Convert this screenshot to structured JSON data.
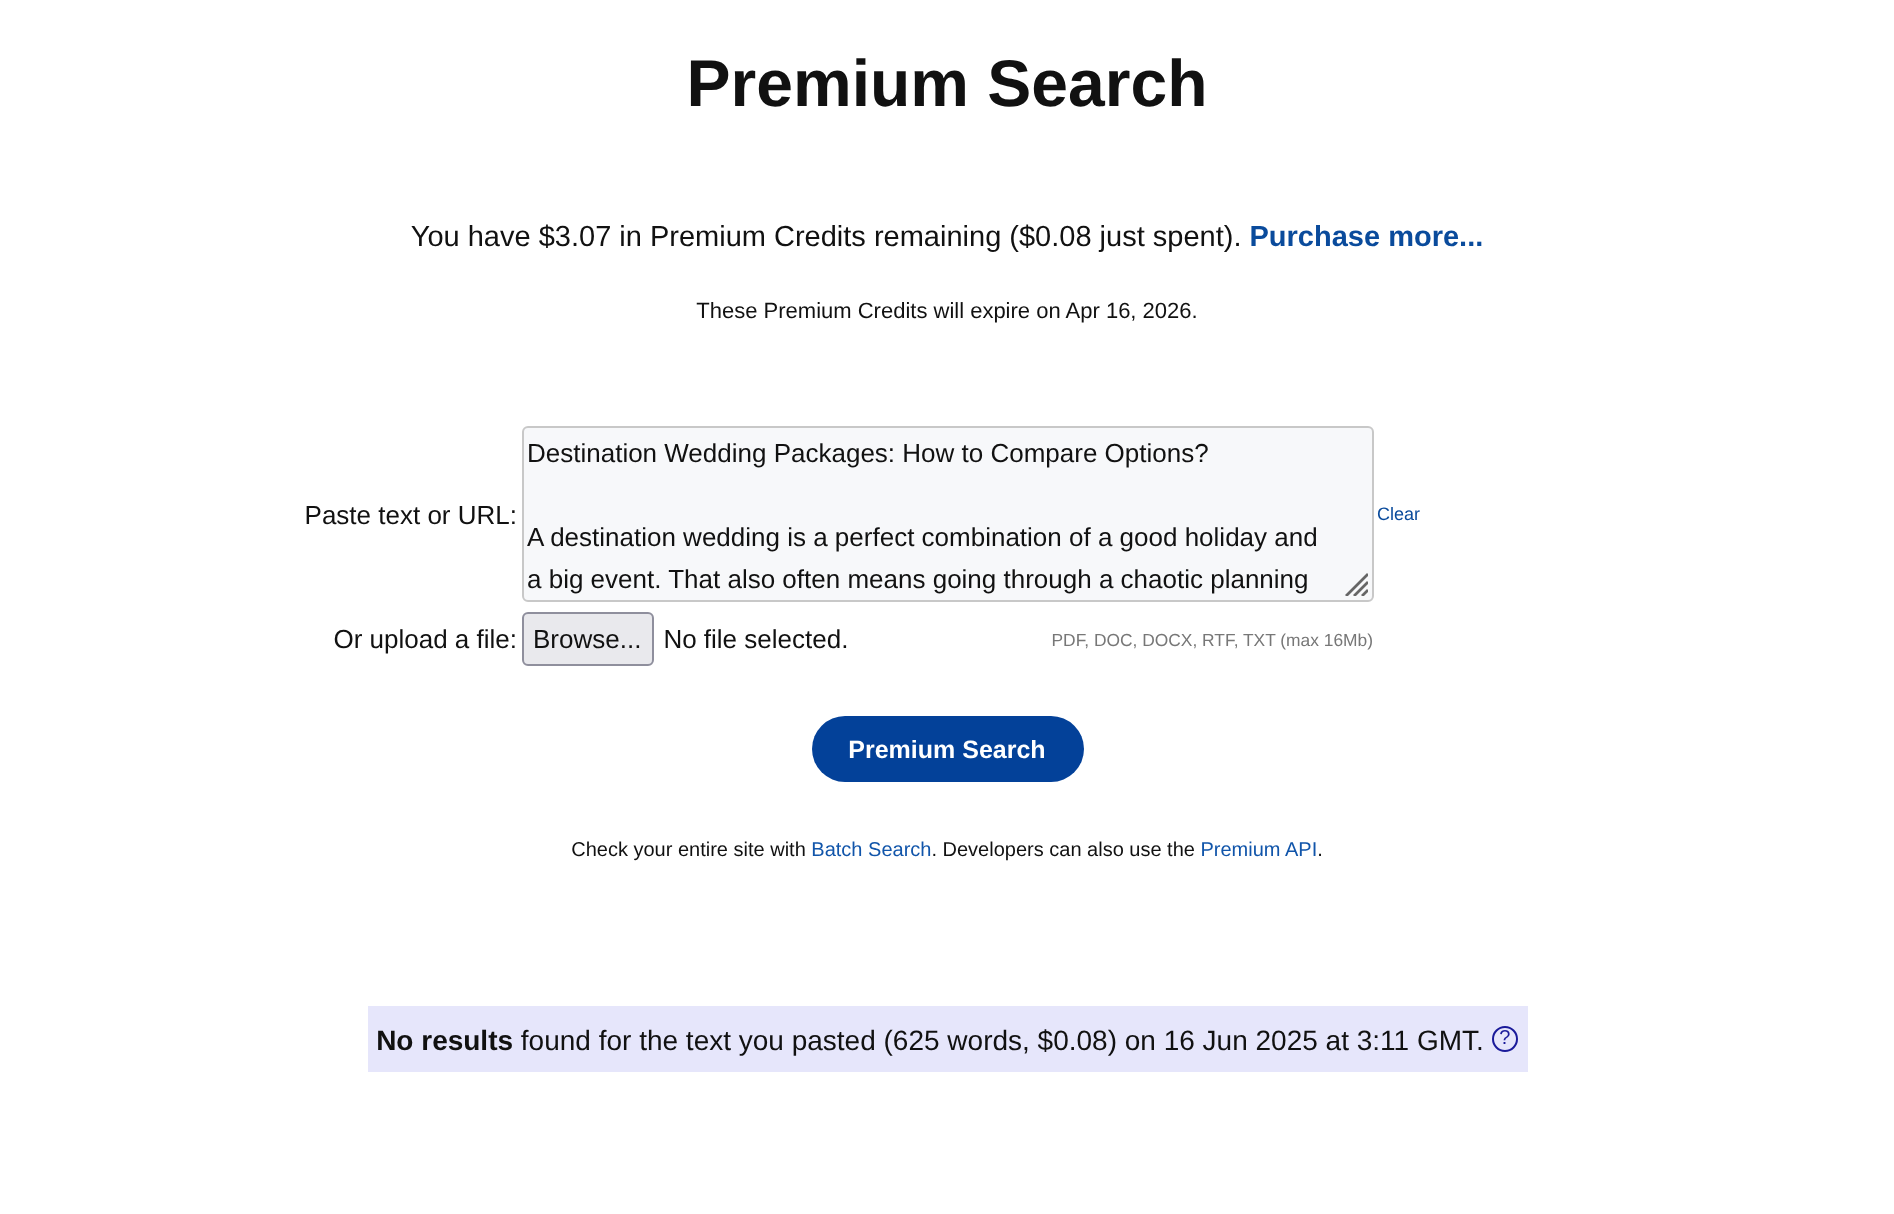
{
  "title": "Premium Search",
  "credits": {
    "text": "You have $3.07 in Premium Credits remaining ($0.08 just spent).",
    "link": "Purchase more..."
  },
  "expiry": "These Premium Credits will expire on Apr 16, 2026.",
  "form": {
    "text_label": "Paste text or URL:",
    "text_value": "Destination Wedding Packages: How to Compare Options?\n\nA destination wedding is a perfect combination of a good holiday and\na big event. That also often means going through a chaotic planning",
    "clear": "Clear",
    "upload_label": "Or upload a file:",
    "browse": "Browse...",
    "file_status": "No file selected.",
    "file_hint": "PDF, DOC, DOCX, RTF, TXT (max 16Mb)"
  },
  "submit": "Premium Search",
  "info": [
    {
      "kind": "text",
      "text": "Check your entire site with "
    },
    {
      "kind": "link",
      "text": "Batch Search"
    },
    {
      "kind": "text",
      "text": ". Developers can also use the "
    },
    {
      "kind": "link",
      "text": "Premium API"
    },
    {
      "kind": "text",
      "text": "."
    }
  ],
  "result": {
    "text": "**No results** found for the text you pasted (625 words, $0.08) on 16 Jun 2025 at 3:11 GMT.",
    "help": "?"
  }
}
